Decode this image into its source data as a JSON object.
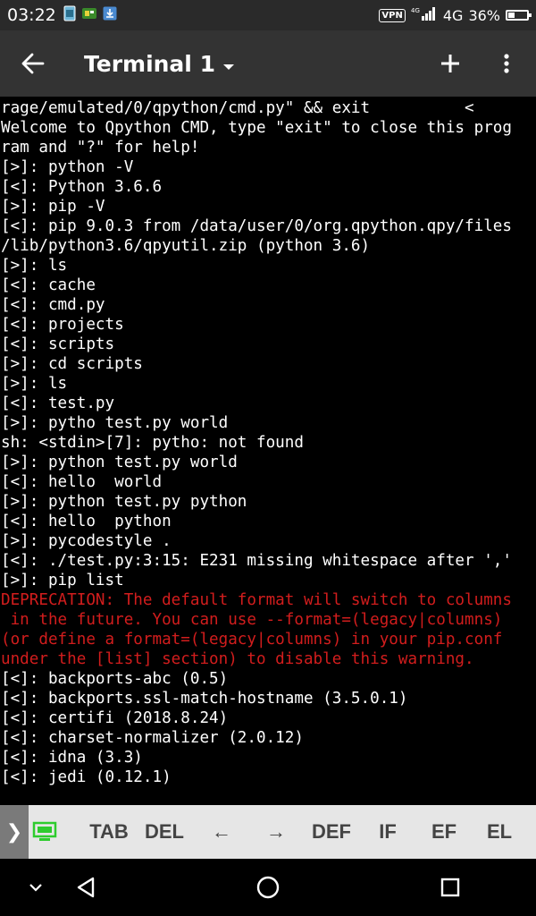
{
  "statusbar": {
    "time": "03:22",
    "vpn": "VPN",
    "network": "4G",
    "battery_percent": "36%",
    "battery_level": 0.36
  },
  "appbar": {
    "title": "Terminal 1"
  },
  "terminal": {
    "lines": [
      {
        "text": "rage/emulated/0/qpython/cmd.py\" && exit          <",
        "type": "normal"
      },
      {
        "text": "Welcome to Qpython CMD, type \"exit\" to close this prog",
        "type": "normal"
      },
      {
        "text": "ram and \"?\" for help!",
        "type": "normal"
      },
      {
        "text": "[>]: python -V",
        "type": "normal"
      },
      {
        "text": "[<]: Python 3.6.6",
        "type": "normal"
      },
      {
        "text": "[>]: pip -V",
        "type": "normal"
      },
      {
        "text": "[<]: pip 9.0.3 from /data/user/0/org.qpython.qpy/files",
        "type": "normal"
      },
      {
        "text": "/lib/python3.6/qpyutil.zip (python 3.6)",
        "type": "normal"
      },
      {
        "text": "[>]: ls",
        "type": "normal"
      },
      {
        "text": "[<]: cache",
        "type": "normal"
      },
      {
        "text": "[<]: cmd.py",
        "type": "normal"
      },
      {
        "text": "[<]: projects",
        "type": "normal"
      },
      {
        "text": "[<]: scripts",
        "type": "normal"
      },
      {
        "text": "[>]: cd scripts",
        "type": "normal"
      },
      {
        "text": "[>]: ls",
        "type": "normal"
      },
      {
        "text": "[<]: test.py",
        "type": "normal"
      },
      {
        "text": "[>]: pytho test.py world",
        "type": "normal"
      },
      {
        "text": "sh: <stdin>[7]: pytho: not found",
        "type": "normal"
      },
      {
        "text": "[>]: python test.py world",
        "type": "normal"
      },
      {
        "text": "[<]: hello  world",
        "type": "normal"
      },
      {
        "text": "[>]: python test.py python",
        "type": "normal"
      },
      {
        "text": "[<]: hello  python",
        "type": "normal"
      },
      {
        "text": "[>]: pycodestyle .",
        "type": "normal"
      },
      {
        "text": "[<]: ./test.py:3:15: E231 missing whitespace after ','",
        "type": "normal"
      },
      {
        "text": "[>]: pip list",
        "type": "normal"
      },
      {
        "text": "DEPRECATION: The default format will switch to columns",
        "type": "err"
      },
      {
        "text": " in the future. You can use --format=(legacy|columns)",
        "type": "err"
      },
      {
        "text": "(or define a format=(legacy|columns) in your pip.conf",
        "type": "err"
      },
      {
        "text": "under the [list] section) to disable this warning.",
        "type": "err"
      },
      {
        "text": "[<]: backports-abc (0.5)",
        "type": "normal"
      },
      {
        "text": "[<]: backports.ssl-match-hostname (3.5.0.1)",
        "type": "normal"
      },
      {
        "text": "[<]: certifi (2018.8.24)",
        "type": "normal"
      },
      {
        "text": "[<]: charset-normalizer (2.0.12)",
        "type": "normal"
      },
      {
        "text": "[<]: idna (3.3)",
        "type": "normal"
      },
      {
        "text": "[<]: jedi (0.12.1)",
        "type": "normal"
      }
    ]
  },
  "keybar": {
    "expand": "❯",
    "keys": [
      {
        "label": "TAB",
        "name": "key-tab"
      },
      {
        "label": "DEL",
        "name": "key-del"
      },
      {
        "label": "←",
        "name": "key-left-arrow"
      },
      {
        "label": "→",
        "name": "key-right-arrow"
      },
      {
        "label": "DEF",
        "name": "key-def"
      },
      {
        "label": "IF",
        "name": "key-if"
      },
      {
        "label": "EF",
        "name": "key-ef"
      },
      {
        "label": "EL",
        "name": "key-el"
      }
    ]
  },
  "colors": {
    "statusbar_bg": "#2a2a2a",
    "appbar_bg": "#333333",
    "terminal_bg": "#000000",
    "terminal_text": "#ffffff",
    "terminal_error": "#d21d1d",
    "keybar_bg": "#e6e6e6",
    "keyboard_icon": "#2ecc2e"
  },
  "icons": {
    "back": "arrow-back-icon",
    "caret": "caret-down-icon",
    "add": "plus-icon",
    "more": "more-vert-icon",
    "keyboard": "keyboard-icon",
    "nav_hide": "chevron-down-icon",
    "nav_back": "triangle-back-icon",
    "nav_home": "circle-home-icon",
    "nav_recents": "square-recents-icon"
  }
}
